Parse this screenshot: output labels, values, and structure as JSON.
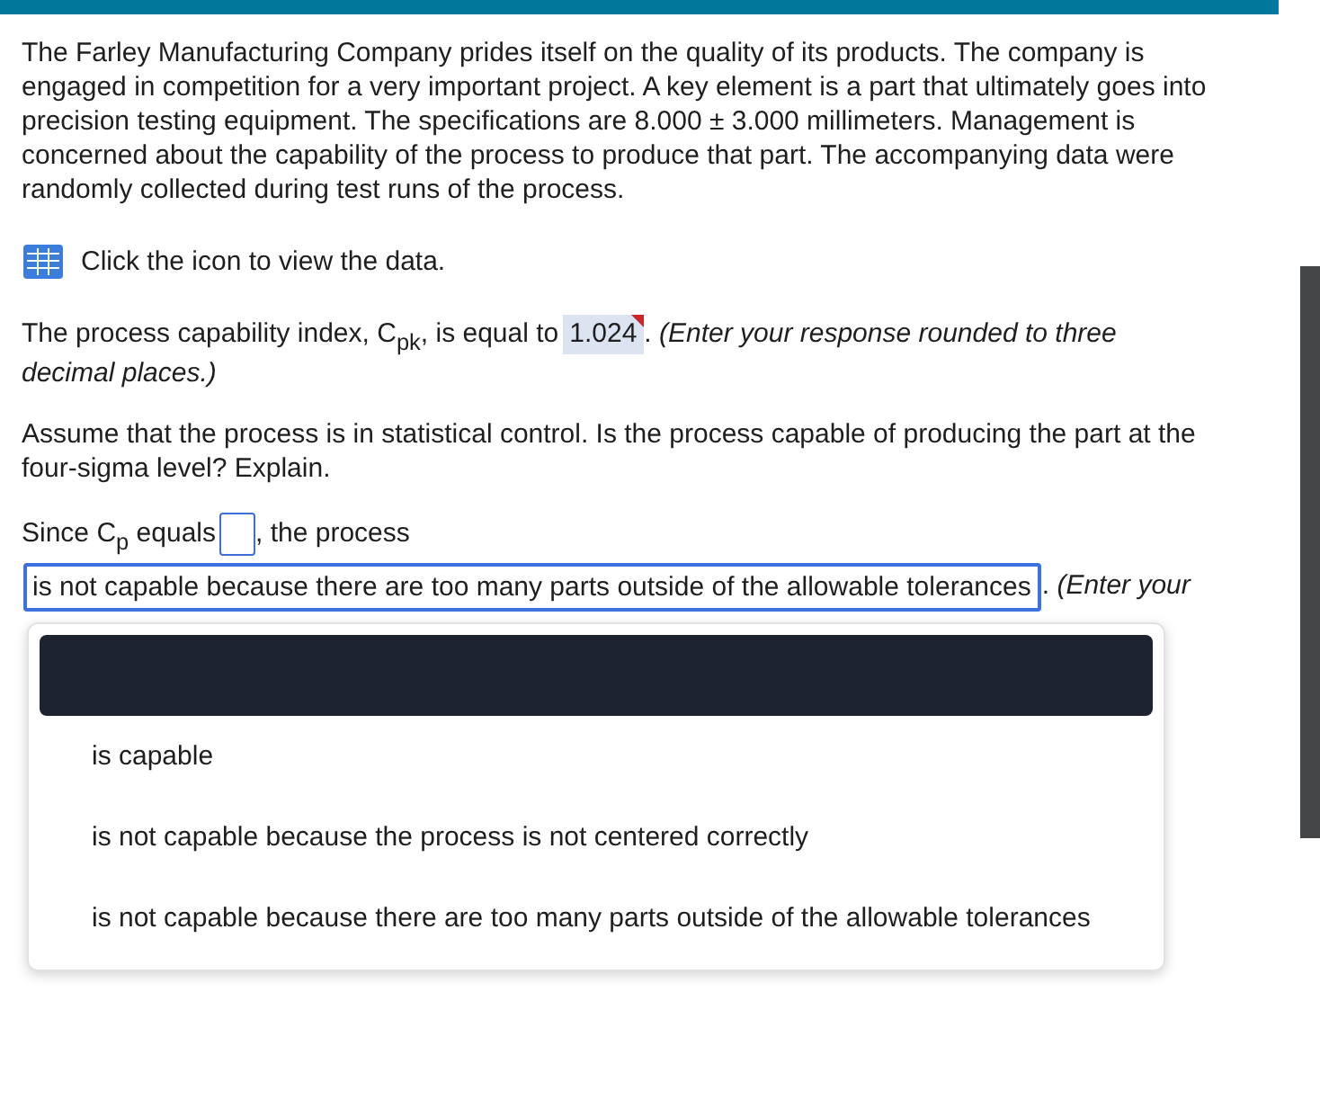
{
  "problem": {
    "paragraph": "The Farley Manufacturing Company prides itself on the quality of its products. The company is engaged in competition for a very important project. A key element is a part that ultimately goes into precision testing equipment. The specifications are 8.000 ± 3.000 millimeters. Management is concerned about the capability of the process to produce that part. The accompanying data were randomly collected during test runs of the process."
  },
  "data_link": {
    "label": "Click the icon to view the data."
  },
  "question_1": {
    "prompt": "The process capability index, C$_{pk}$, is equal to",
    "answer": {
      "value": "1.024",
      "flagged": true
    },
    "note": ". *(Enter your response rounded to three*",
    "note_continued": "decimal places.)"
  },
  "question_2": {
    "prompt": "Assume that the process is in statistical control. Is the process capable of producing the part at the four-sigma level? Explain."
  },
  "answer_line": {
    "lead": "Since C$_{p}$ equals",
    "middle": ", the process",
    "select": {
      "value": "is not capable because there are too many parts outside of the allowable tolerances",
      "expanded": true
    },
    "note": ". *(Enter your*"
  },
  "menu": {
    "options": [
      {
        "kind": "blank",
        "highlighted": true
      },
      {
        "kind": "choice",
        "label": "is capable",
        "highlighted": false
      },
      {
        "kind": "choice",
        "label": "is not capable because the process is not centered correctly",
        "highlighted": false
      },
      {
        "kind": "choice",
        "label": "is not capable because there are too many parts outside of the allowable tolerances",
        "highlighted": false
      }
    ]
  }
}
